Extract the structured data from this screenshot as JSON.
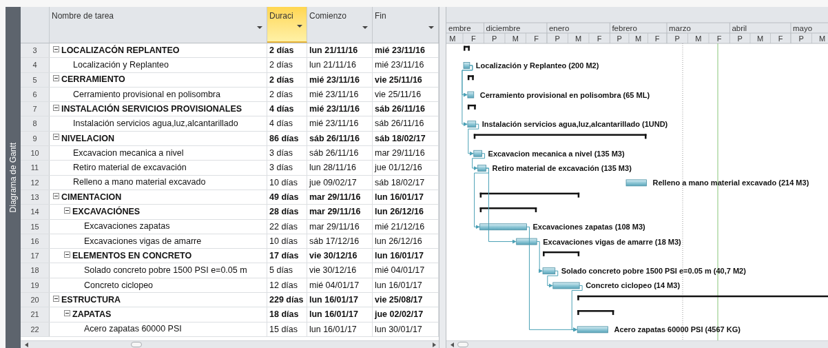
{
  "side_label": "Diagrama de Gantt",
  "columns": [
    {
      "label": "Nombre de tarea",
      "selected": false
    },
    {
      "label": "Duraci",
      "selected": true
    },
    {
      "label": "Comienzo",
      "selected": false
    },
    {
      "label": "Fin",
      "selected": false
    }
  ],
  "tasks": [
    {
      "id": "3",
      "name": "LOCALIZACÓN REPLANTEO",
      "duration": "2 días",
      "start": "lun 21/11/16",
      "finish": "mié 23/11/16",
      "expanded": true,
      "children": [
        {
          "id": "4",
          "name": "Localización y Replanteo",
          "duration": "2 días",
          "start": "lun 21/11/16",
          "finish": "mié 23/11/16",
          "bar_label": "Localización y Replanteo (200 M2)"
        }
      ]
    },
    {
      "id": "5",
      "name": "CERRAMIENTO",
      "duration": "2 días",
      "start": "mié 23/11/16",
      "finish": "vie 25/11/16",
      "expanded": true,
      "children": [
        {
          "id": "6",
          "name": "Cerramiento provisional en polisombra",
          "duration": "2 días",
          "start": "mié 23/11/16",
          "finish": "vie 25/11/16",
          "bar_label": "Cerramiento provisional en polisombra (65 ML)"
        }
      ]
    },
    {
      "id": "7",
      "name": "INSTALACIÓN SERVICIOS PROVISIONALES",
      "duration": "4 días",
      "start": "mié 23/11/16",
      "finish": "sáb 26/11/16",
      "expanded": true,
      "children": [
        {
          "id": "8",
          "name": "Instalación servicios agua,luz,alcantarillado",
          "duration": "4 días",
          "start": "mié 23/11/16",
          "finish": "sáb 26/11/16",
          "bar_label": "Instalación servicios agua,luz,alcantarillado (1UND)"
        }
      ]
    },
    {
      "id": "9",
      "name": "NIVELACION",
      "duration": "86 días",
      "start": "sáb 26/11/16",
      "finish": "sáb 18/02/17",
      "expanded": true,
      "children": [
        {
          "id": "10",
          "name": "Excavacion mecanica a nivel",
          "duration": "3 días",
          "start": "sáb 26/11/16",
          "finish": "mar 29/11/16",
          "bar_label": "Excavacion mecanica a nivel (135 M3)"
        },
        {
          "id": "11",
          "name": "Retiro material de excavación",
          "duration": "3 días",
          "start": "lun 28/11/16",
          "finish": "jue 01/12/16",
          "bar_label": "Retiro material de excavación (135 M3)"
        },
        {
          "id": "12",
          "name": "Relleno a mano material excavado",
          "duration": "10 días",
          "start": "jue 09/02/17",
          "finish": "sáb 18/02/17",
          "bar_label": "Relleno a mano material excavado (214 M3)"
        }
      ]
    },
    {
      "id": "13",
      "name": "CIMENTACION",
      "duration": "49 días",
      "start": "mar 29/11/16",
      "finish": "lun 16/01/17",
      "expanded": true,
      "children": [
        {
          "id": "14",
          "name": "EXCAVACIÓNES",
          "duration": "28 días",
          "start": "mar 29/11/16",
          "finish": "lun 26/12/16",
          "expanded": true,
          "children": [
            {
              "id": "15",
              "name": "Excavaciones zapatas",
              "duration": "22 días",
              "start": "mar 29/11/16",
              "finish": "mié 21/12/16",
              "bar_label": "Excavaciones zapatas (108 M3)"
            },
            {
              "id": "16",
              "name": "Excavaciones vigas de amarre",
              "duration": "10 días",
              "start": "sáb 17/12/16",
              "finish": "lun 26/12/16",
              "bar_label": "Excavaciones vigas de amarre (18 M3)"
            }
          ]
        },
        {
          "id": "17",
          "name": "ELEMENTOS EN CONCRETO",
          "duration": "17 días",
          "start": "vie 30/12/16",
          "finish": "lun 16/01/17",
          "expanded": true,
          "children": [
            {
              "id": "18",
              "name": "Solado concreto pobre 1500 PSI e=0.05 m",
              "duration": "5 días",
              "start": "vie 30/12/16",
              "finish": "mié 04/01/17",
              "bar_label": "Solado concreto pobre 1500 PSI e=0.05 m (40,7 M2)"
            },
            {
              "id": "19",
              "name": "Concreto ciclopeo",
              "duration": "12 días",
              "start": "mié 04/01/17",
              "finish": "lun 16/01/17",
              "bar_label": "Concreto ciclopeo (14 M3)"
            }
          ]
        }
      ]
    },
    {
      "id": "20",
      "name": "ESTRUCTURA",
      "duration": "229 días",
      "start": "lun 16/01/17",
      "finish": "vie 25/08/17",
      "expanded": true,
      "children": [
        {
          "id": "21",
          "name": "ZAPATAS",
          "duration": "18 días",
          "start": "lun 16/01/17",
          "finish": "jue 02/02/17",
          "expanded": true,
          "children": [
            {
              "id": "22",
              "name": "Acero zapatas 60000 PSI",
              "duration": "15 días",
              "start": "lun 16/01/17",
              "finish": "lun 30/01/17",
              "bar_label": "Acero zapatas 60000 PSI (4567 KG)"
            }
          ]
        }
      ]
    }
  ],
  "timescale": {
    "months": [
      {
        "label": "embre",
        "periods": [
          "M",
          "F"
        ]
      },
      {
        "label": "diciembre",
        "periods": [
          "P",
          "M",
          "F"
        ]
      },
      {
        "label": "enero",
        "periods": [
          "P",
          "M",
          "F"
        ]
      },
      {
        "label": "febrero",
        "periods": [
          "P",
          "M",
          "F"
        ]
      },
      {
        "label": "marzo",
        "periods": [
          "P",
          "M",
          "F"
        ]
      },
      {
        "label": "abril",
        "periods": [
          "P",
          "M",
          "F"
        ]
      },
      {
        "label": "mayo",
        "periods": [
          "P",
          "M"
        ]
      }
    ]
  }
}
